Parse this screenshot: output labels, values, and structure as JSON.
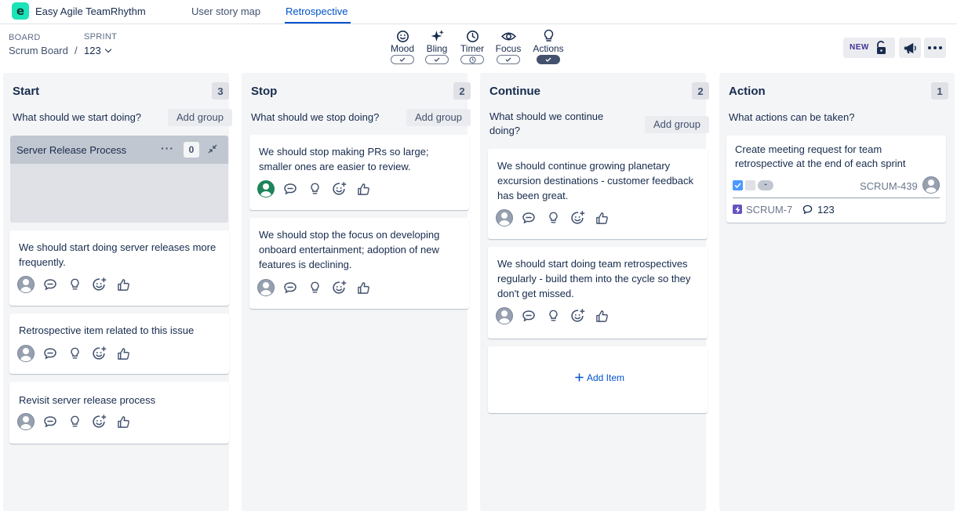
{
  "app": {
    "title": "Easy Agile TeamRhythm",
    "logo_letter": "e"
  },
  "nav": {
    "tabs": [
      {
        "label": "User story map"
      },
      {
        "label": "Retrospective"
      }
    ],
    "active": "Retrospective"
  },
  "board": {
    "label": "BOARD",
    "value": "Scrum Board",
    "separator": "/"
  },
  "sprint": {
    "label": "SPRINT",
    "value": "123"
  },
  "tools": [
    {
      "label": "Mood",
      "icon": "smiley-icon",
      "toggle": "check"
    },
    {
      "label": "Bling",
      "icon": "sparkle-icon",
      "toggle": "check"
    },
    {
      "label": "Timer",
      "icon": "clock-icon",
      "toggle": "clock"
    },
    {
      "label": "Focus",
      "icon": "eye-icon",
      "toggle": "check"
    },
    {
      "label": "Actions",
      "icon": "lightbulb-icon",
      "toggle": "check-active"
    }
  ],
  "header_actions": {
    "new_badge": "NEW"
  },
  "columns": [
    {
      "title": "Start",
      "count": "3",
      "question": "What should we start doing?",
      "add_group": "Add group",
      "group": {
        "title": "Server Release Process",
        "count": "0"
      },
      "cards": [
        {
          "text": "We should start doing server releases more frequently."
        },
        {
          "text": "Retrospective item related to this issue"
        },
        {
          "text": "Revisit server release process"
        }
      ]
    },
    {
      "title": "Stop",
      "count": "2",
      "question": "What should we stop doing?",
      "add_group": "Add group",
      "cards": [
        {
          "text": "We should stop making PRs so large; smaller ones are easier to review."
        },
        {
          "text": "We should stop the focus on developing onboard entertainment; adoption of new features is declining."
        }
      ]
    },
    {
      "title": "Continue",
      "count": "2",
      "question": "What should we continue doing?",
      "add_group": "Add group",
      "cards": [
        {
          "text": "We should continue growing planetary excursion destinations - customer feedback has been great."
        },
        {
          "text": "We should start doing team retrospectives regularly - build them into the cycle so they don't get missed."
        }
      ],
      "add_item": "Add Item"
    },
    {
      "title": "Action",
      "count": "1",
      "question": "What actions can be taken?",
      "action_card": {
        "text": "Create meeting request for team retrospective at the end of each sprint",
        "pill": "-",
        "issue_key": "SCRUM-439",
        "epic_key": "SCRUM-7",
        "comments": "123"
      }
    }
  ],
  "colors": {
    "accent": "#0052cc",
    "logo": "#1de3b8",
    "column_bg": "#f4f5f7",
    "group_header": "#c1c7d0",
    "epic": "#6554c0",
    "checkbox": "#4c9aff",
    "avatar_green": "#1f845a"
  }
}
